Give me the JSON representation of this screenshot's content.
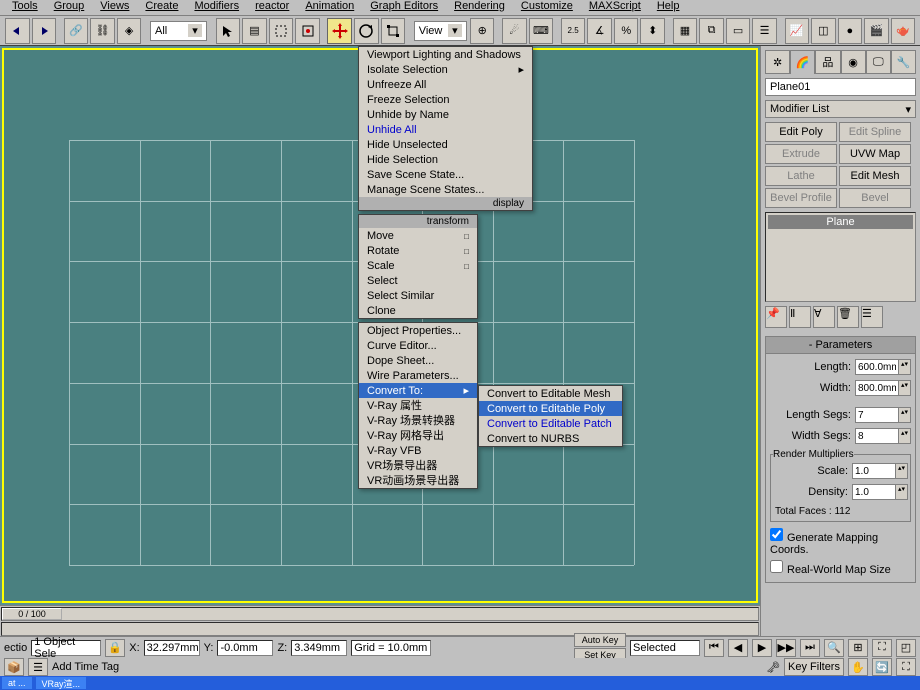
{
  "menubar": [
    "Tools",
    "Group",
    "Views",
    "Create",
    "Modifiers",
    "reactor",
    "Animation",
    "Graph Editors",
    "Rendering",
    "Customize",
    "MAXScript",
    "Help"
  ],
  "toolbar": {
    "filter": "All",
    "refsys": "View",
    "snap": "2.5"
  },
  "contextMenu": {
    "display": [
      "Viewport Lighting and Shadows",
      "Isolate Selection",
      "Unfreeze All",
      "Freeze Selection",
      "Unhide by Name",
      "Unhide All",
      "Hide Unselected",
      "Hide Selection",
      "Save Scene State...",
      "Manage Scene States..."
    ],
    "displayTitle": "display",
    "transform": [
      "Move",
      "Rotate",
      "Scale",
      "Select",
      "Select Similar",
      "Clone"
    ],
    "transformTitle": "transform",
    "tools": [
      "Object Properties...",
      "Curve Editor...",
      "Dope Sheet...",
      "Wire Parameters...",
      "Convert To:",
      "V-Ray 属性",
      "V-Ray 场景转换器",
      "V-Ray 网格导出",
      "V-Ray VFB",
      "VR场景导出器",
      "VR动画场景导出器"
    ],
    "convert": [
      "Convert to Editable Mesh",
      "Convert to Editable Poly",
      "Convert to Editable Patch",
      "Convert to NURBS"
    ]
  },
  "rpanel": {
    "objName": "Plane01",
    "modList": "Modifier List",
    "modBtns": [
      "Edit Poly",
      "Edit Spline",
      "Extrude",
      "UVW Map",
      "Lathe",
      "Edit Mesh",
      "Bevel Profile",
      "Bevel"
    ],
    "stackItem": "Plane",
    "params": {
      "title": "Parameters",
      "length": "600.0mm",
      "width": "800.0mm",
      "lsegs": "7",
      "wsegs": "8",
      "rmTitle": "Render Multipliers",
      "scale": "1.0",
      "density": "1.0",
      "faces": "Total Faces : 112",
      "genMap": "Generate Mapping Coords.",
      "realWorld": "Real-World Map Size"
    }
  },
  "timeline": {
    "pos": "0 / 100"
  },
  "status": {
    "sel": "1 Object Sele",
    "x": "32.297mm",
    "y": "-0.0mm",
    "z": "3.349mm",
    "grid": "Grid = 10.0mm",
    "autoKey": "Auto Key",
    "setKey": "Set Key",
    "selected": "Selected",
    "keyFilters": "Key Filters",
    "addTag": "Add Time Tag"
  },
  "taskbar": [
    "at ...",
    "VRay渲..."
  ]
}
